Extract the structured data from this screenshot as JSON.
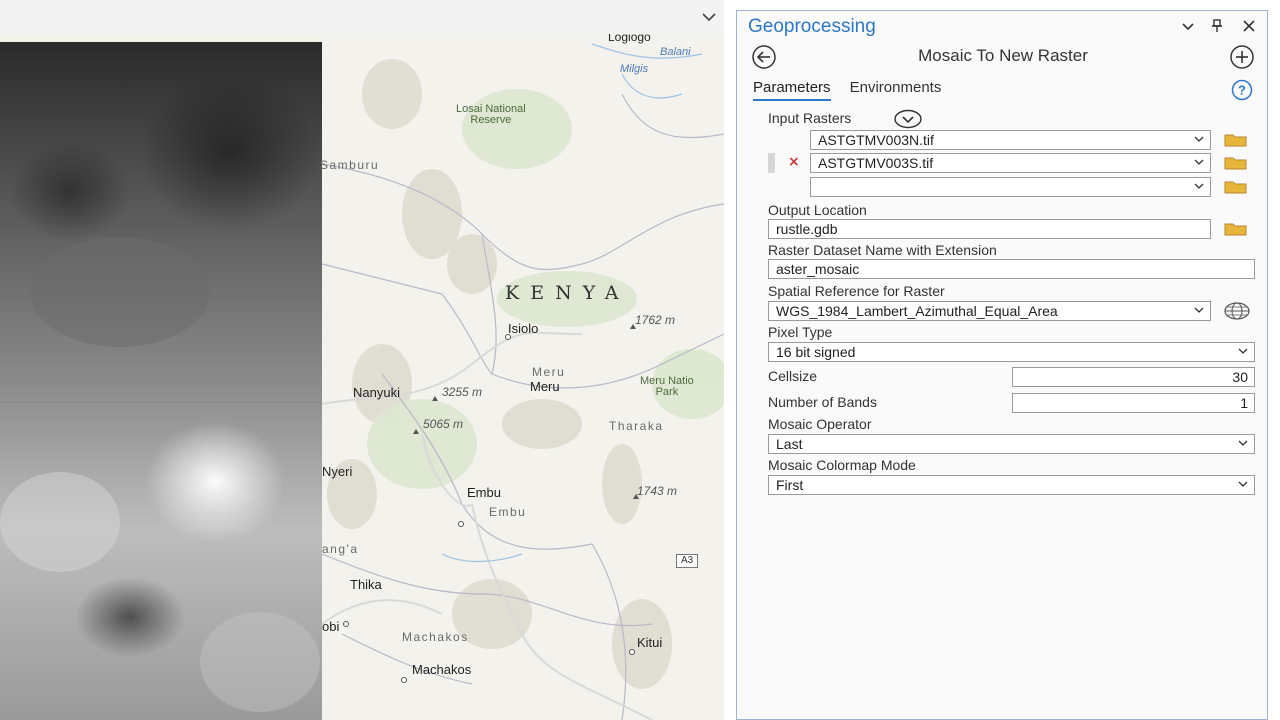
{
  "map": {
    "labels": {
      "logiogo": "Logiogo",
      "balani": "Balani",
      "milgis": "Milgis",
      "losai_park": "Losai National\nReserve",
      "samburu": "Samburu",
      "kenya": "KENYA",
      "isiolo": "Isiolo",
      "elev_1762": "1762 m",
      "meru_region": "Meru",
      "meru_town": "Meru",
      "meru_park": "Meru Natio\nPark",
      "nanyuki": "Nanyuki",
      "elev_3255": "3255 m",
      "elev_5065": "5065 m",
      "tharaka": "Tharaka",
      "nyeri": "Nyeri",
      "embu_town": "Embu",
      "embu_region": "Embu",
      "elev_1743": "1743 m",
      "muranga": "ang'a",
      "a3": "A3",
      "thika": "Thika",
      "nairobi": "obi",
      "machakos_region": "Machakos",
      "kitui": "Kitui",
      "machakos_town": "Machakos"
    }
  },
  "pane": {
    "title": "Geoprocessing",
    "tool_title": "Mosaic To New Raster",
    "tabs": [
      "Parameters",
      "Environments"
    ],
    "input_rasters_label": "Input Rasters",
    "input_rasters": [
      "ASTGTMV003N.tif",
      "ASTGTMV003S.tif",
      ""
    ],
    "output_location_label": "Output Location",
    "output_location": "rustle.gdb",
    "dataset_name_label": "Raster Dataset Name with Extension",
    "dataset_name": "aster_mosaic",
    "spatial_ref_label": "Spatial Reference for  Raster",
    "spatial_ref": "WGS_1984_Lambert_Azimuthal_Equal_Area",
    "pixel_type_label": "Pixel Type",
    "pixel_type": "16 bit signed",
    "cellsize_label": "Cellsize",
    "cellsize": "30",
    "bands_label": "Number of Bands",
    "bands": "1",
    "operator_label": "Mosaic Operator",
    "operator": "Last",
    "colormap_label": "Mosaic Colormap Mode",
    "colormap": "First",
    "remove_mark": "×"
  },
  "colors": {
    "accent": "#2b78c8",
    "folder": "#e7b53a",
    "remove": "#d03434"
  },
  "icons": [
    "chevron-down-icon",
    "pin-icon",
    "close-icon",
    "back-arrow-icon",
    "add-icon",
    "help-icon",
    "expand-icon",
    "folder-icon",
    "globe-icon"
  ]
}
